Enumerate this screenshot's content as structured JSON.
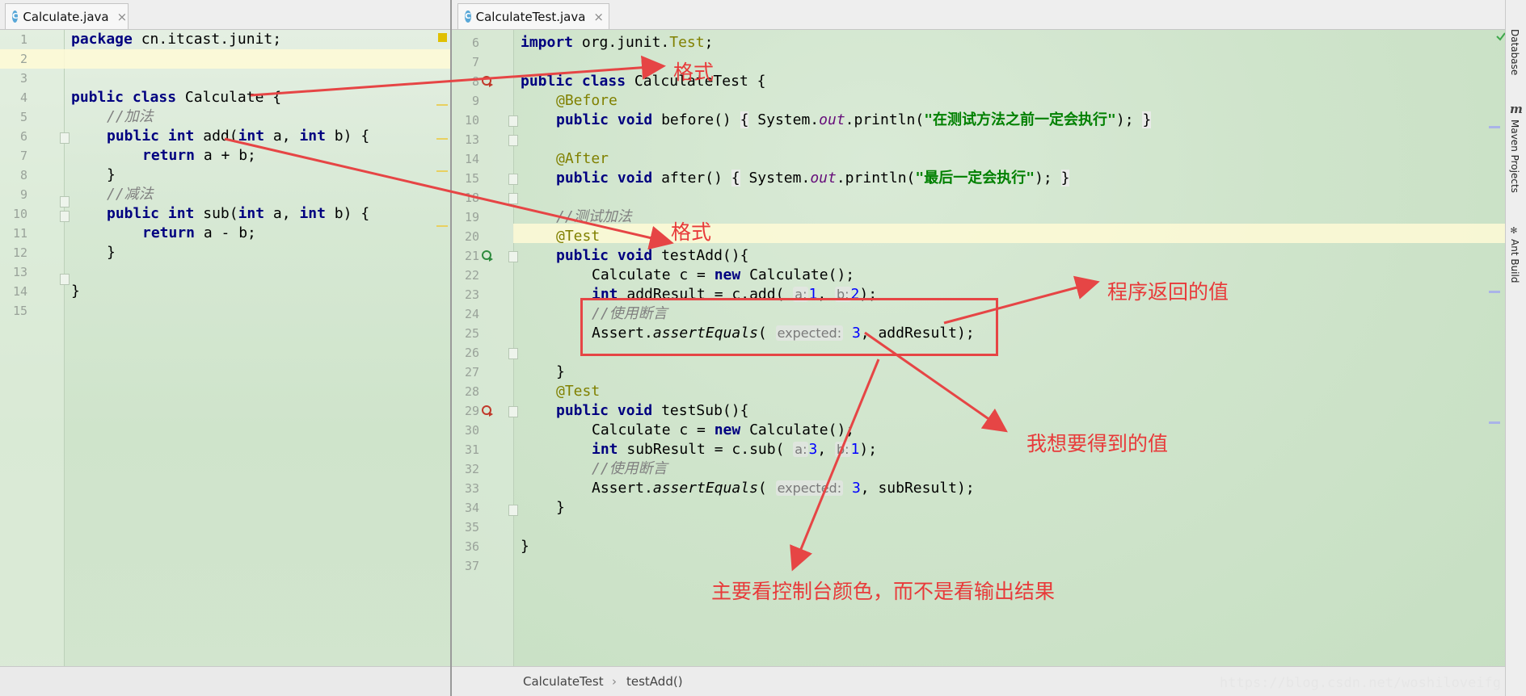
{
  "left_tab": {
    "icon": "C",
    "label": "Calculate.java",
    "close": "×"
  },
  "right_tab": {
    "icon": "C",
    "label": "CalculateTest.java",
    "close": "×"
  },
  "left_editor": {
    "line_numbers": [
      "1",
      "2",
      "3",
      "4",
      "5",
      "6",
      "7",
      "8",
      "9",
      "10",
      "11",
      "12",
      "13",
      "14",
      "15"
    ]
  },
  "right_editor": {
    "line_numbers": [
      "6",
      "7",
      "8",
      "9",
      "10",
      "13",
      "14",
      "15",
      "18",
      "19",
      "20",
      "21",
      "22",
      "23",
      "24",
      "25",
      "26",
      "27",
      "28",
      "29",
      "30",
      "31",
      "32",
      "33",
      "34",
      "35",
      "36",
      "37"
    ]
  },
  "code": {
    "l_package_kw": "package",
    "l_package_rest": " cn.itcast.junit;",
    "l_public": "public",
    "l_class": "class",
    "l_class_name": " Calculate {",
    "l_cmt_add": "//加法",
    "l_add_sig_1": "public",
    "l_int": "int",
    "l_add_name": " add(",
    "l_a": " a, ",
    "l_b": " b) {",
    "l_return": "return",
    "l_add_body": " a + b;",
    "l_close": "}",
    "l_cmt_sub": "//减法",
    "l_sub_name": " sub(",
    "l_sub_body": " a - b;",
    "r_import": "import",
    "r_import_rest": " org.junit.",
    "r_import_test": "Test",
    "r_semicolon": ";",
    "r_class_name": " CalculateTest {",
    "r_before_ann": "@Before",
    "r_void": "void",
    "r_before_sig": " before() ",
    "r_lbrace": "{",
    "r_sysout_1": " System.",
    "r_out": "out",
    "r_println": ".println(",
    "r_str_before": "\"在测试方法之前一定会执行\"",
    "r_end_call": ");",
    "r_rbrace": "}",
    "r_after_ann": "@After",
    "r_after_sig": " after() ",
    "r_str_after": "\"最后一定会执行\"",
    "r_cmt_add": "//测试加法",
    "r_test_ann": "@Test",
    "r_testadd_sig": " testAdd(){",
    "r_new_calc_1": "Calculate c = ",
    "r_new": "new",
    "r_new_calc_2": " Calculate();",
    "r_addresult_1": " addResult = c.add( ",
    "r_hint_a": "a:",
    "r_one": "1",
    "r_comma": ", ",
    "r_hint_b": "b:",
    "r_two": "2",
    "r_cmt_assert": "//使用断言",
    "r_assert_1": "Assert.",
    "r_assert_method": "assertEquals",
    "r_paren": "( ",
    "r_hint_expected": "expected:",
    "r_three": "3",
    "r_addresult_end": ", addResult);",
    "r_testsub_sig": " testSub(){",
    "r_subresult_1": " subResult = c.sub( ",
    "r_subresult_end": ", subResult);"
  },
  "breadcrumbs": [
    "CalculateTest",
    "›",
    "testAdd()"
  ],
  "watermark": "https://blog.csdn.net/woshiloveifg",
  "tool_windows": [
    "Database",
    "Maven Projects",
    "Ant Build"
  ],
  "annotations": {
    "format_1": "格式",
    "format_2": "格式",
    "return_value": "程序返回的值",
    "expected_value": "我想要得到的值",
    "console_note": "主要看控制台颜色，而不是看输出结果"
  },
  "colors": {
    "annotation_red": "#e83a3a",
    "keyword": "#000080",
    "string": "#008000",
    "comment": "#808080",
    "annotation": "#808000",
    "number": "#0000ff"
  }
}
